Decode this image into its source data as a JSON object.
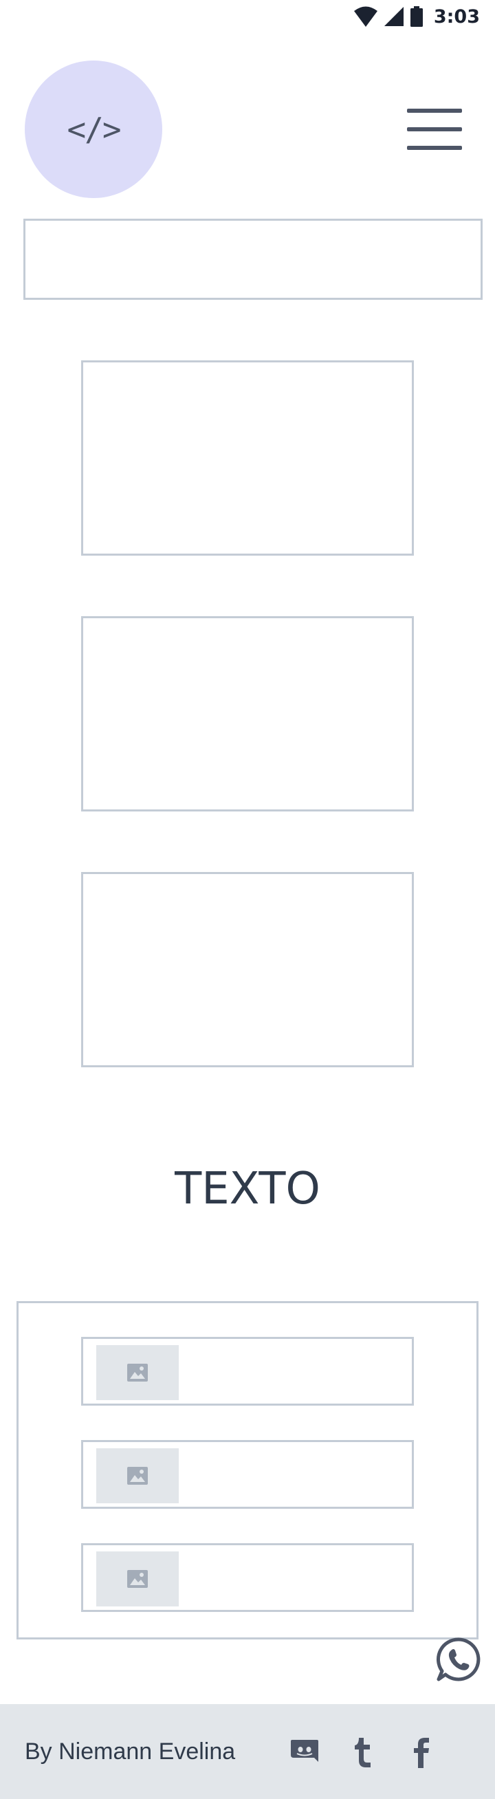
{
  "status_bar": {
    "time": "3:03",
    "icons": [
      "wifi-icon",
      "cellular-signal-icon",
      "battery-icon"
    ]
  },
  "header": {
    "logo_glyph": "</>",
    "logo_icon": "code-icon",
    "menu_icon": "hamburger-menu-icon"
  },
  "main": {
    "heading": "TEXTO",
    "list_item_icons": [
      "image-icon",
      "image-icon",
      "image-icon"
    ]
  },
  "floating": {
    "icon": "whatsapp-icon"
  },
  "footer": {
    "author": "By Niemann Evelina",
    "social_icons": [
      "discord-icon",
      "tumblr-icon",
      "facebook-icon"
    ]
  },
  "colors": {
    "logo_bg": "#dcdcf9",
    "border": "#c4ccd6",
    "footer_bg": "#e2e6ea",
    "text": "#2f3a4a"
  }
}
